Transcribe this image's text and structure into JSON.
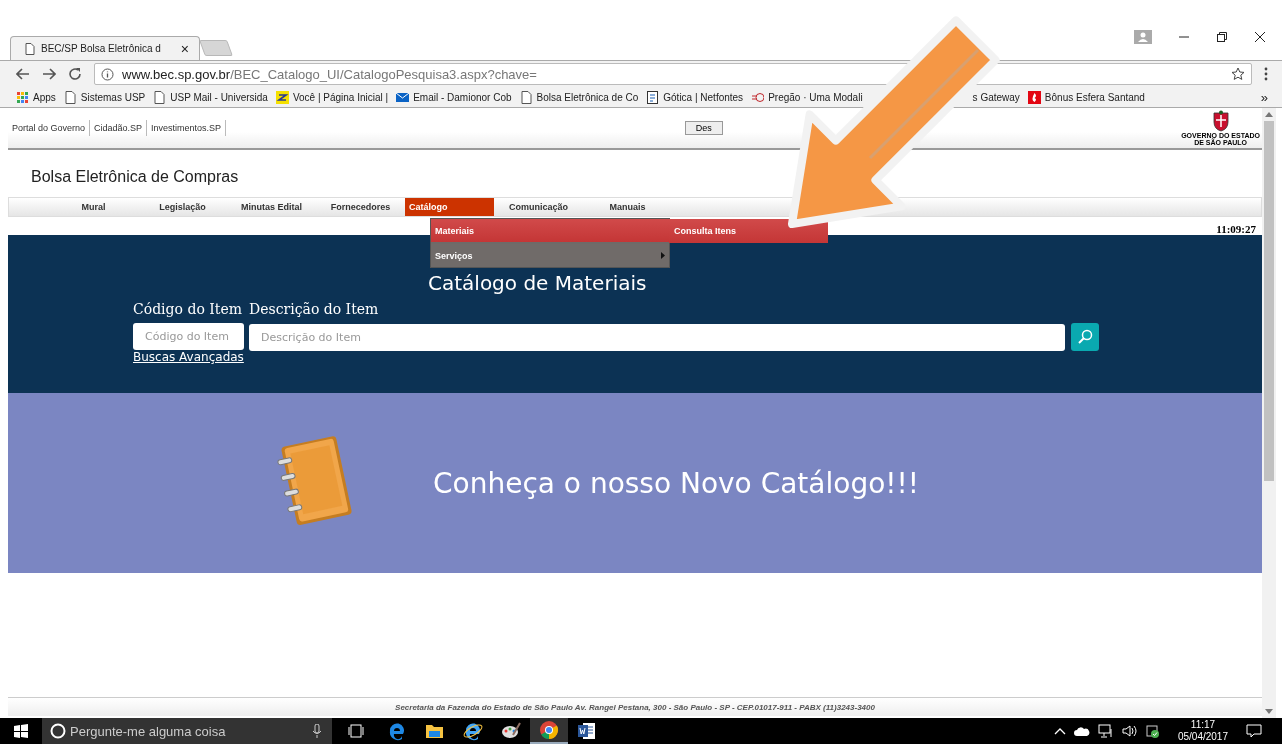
{
  "browser": {
    "tabs": [
      {
        "title": "BEC/SP Bolsa Eletrônica d",
        "kind": "page"
      },
      {
        "kind": "new"
      }
    ],
    "close_glyph": "×",
    "url": {
      "host": "www.bec.sp.gov.br",
      "path": "/BEC_Catalogo_UI/CatalogoPesquisa3.aspx?chave="
    },
    "bookmarks": [
      {
        "label": "Apps",
        "kind": "apps"
      },
      {
        "label": "Sistemas USP",
        "kind": "page"
      },
      {
        "label": "USP Mail - Universida",
        "kind": "page"
      },
      {
        "label": "Você | Página Inicial |",
        "kind": "bank"
      },
      {
        "label": "Email - Damionor Cob",
        "kind": "mail"
      },
      {
        "label": "Bolsa Eletrônica de Co",
        "kind": "page"
      },
      {
        "label": "Gótica | Netfontes",
        "kind": "doc"
      },
      {
        "label": "Pregão · Uma Modali",
        "kind": "pregao"
      },
      {
        "label": "s Gateway",
        "kind": "none"
      },
      {
        "label": "Bônus Esfera Santand",
        "kind": "santander"
      }
    ],
    "more": "»"
  },
  "header": {
    "gov_links": [
      "Portal do Governo",
      "Cidadão.SP",
      "Investimentos.SP"
    ],
    "button": "Des",
    "logo_caption": [
      "GOVERNO DO ESTADO",
      "DE SÃO PAULO"
    ],
    "site_title": "Bolsa Eletrônica de Compras"
  },
  "nav": [
    {
      "label": "Mural",
      "selected": false
    },
    {
      "label": "Legislação",
      "selected": false
    },
    {
      "label": "Minutas Edital",
      "selected": false
    },
    {
      "label": "Fornecedores",
      "selected": false
    },
    {
      "label": "Catálogo",
      "selected": true
    },
    {
      "label": "Comunicação",
      "selected": false
    },
    {
      "label": "Manuais",
      "selected": false
    }
  ],
  "menu": [
    {
      "label": "Materiais",
      "selected": true,
      "has_submenu": false
    },
    {
      "label": "Serviços",
      "selected": false,
      "has_submenu": true
    }
  ],
  "submenu": [
    {
      "label": "Consulta Itens",
      "selected": true
    }
  ],
  "clock": "11:09:27",
  "search": {
    "title": "Catálogo de Materiais",
    "code_label": "Código do Item",
    "desc_label": "Descrição do Item",
    "code_placeholder": "Código do Item",
    "desc_placeholder": "Descrição do Item",
    "link": "Buscas Avançadas"
  },
  "banner": {
    "text": "Conheça o nosso Novo Catálogo!!!"
  },
  "footer": "Secretaria da Fazenda do Estado de São Paulo Av. Rangel Pestana, 300 - São Paulo - SP - CEP.01017-911 - PABX (11)3243-3400",
  "taskbar": {
    "search_placeholder": "Pergunte-me alguma coisa",
    "apps": [
      {
        "kind": "edge",
        "selected": false
      },
      {
        "kind": "folder",
        "selected": false
      },
      {
        "kind": "ie",
        "selected": false
      },
      {
        "kind": "paint",
        "selected": false
      },
      {
        "kind": "chrome",
        "selected": true
      },
      {
        "kind": "word",
        "selected": false
      }
    ],
    "time": "11:17",
    "date": "05/04/2017"
  }
}
